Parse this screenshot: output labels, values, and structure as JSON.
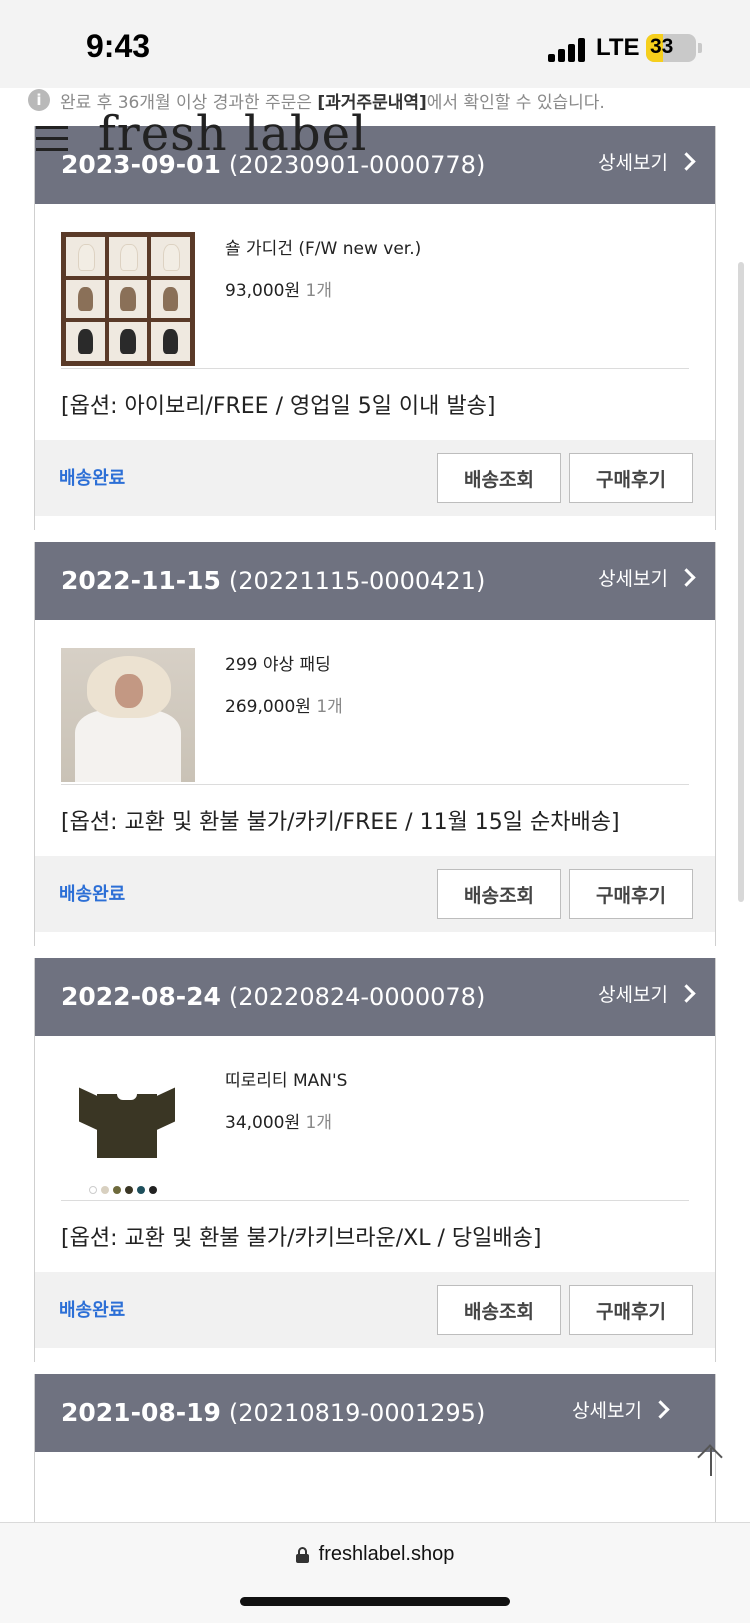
{
  "status_bar": {
    "time": "9:43",
    "network": "LTE",
    "battery": "33",
    "battery_level_pct": 33
  },
  "notice": {
    "prefix": "완료 후 36개월 이상 경과한 주문은 ",
    "link": "[과거주문내역]",
    "suffix": "에서 확인할 수 있습니다."
  },
  "header": {
    "logo": "fresh label"
  },
  "orders": [
    {
      "date": "2023-09-01",
      "order_no": "(20230901-0000778)",
      "detail_label": "상세보기",
      "product_name": "숄 가디건 (F/W new ver.)",
      "price": "93,000원",
      "qty": "1개",
      "options": "[옵션: 아이보리/FREE / 영업일 5일 이내 발송]",
      "status": "배송완료",
      "track_label": "배송조회",
      "review_label": "구매후기",
      "thumb_icon": "shawl-cardigan-image"
    },
    {
      "date": "2022-11-15",
      "order_no": "(20221115-0000421)",
      "detail_label": "상세보기",
      "product_name": "299 야상 패딩",
      "price": "269,000원",
      "qty": "1개",
      "options": "[옵션: 교환 및 환불 불가/카키/FREE / 11월 15일 순차배송]",
      "status": "배송완료",
      "track_label": "배송조회",
      "review_label": "구매후기",
      "thumb_icon": "padding-jacket-image"
    },
    {
      "date": "2022-08-24",
      "order_no": "(20220824-0000078)",
      "detail_label": "상세보기",
      "product_name": "띠로리티 MAN'S",
      "price": "34,000원",
      "qty": "1개",
      "options": "[옵션: 교환 및 환불 불가/카키브라운/XL / 당일배송]",
      "status": "배송완료",
      "track_label": "배송조회",
      "review_label": "구매후기",
      "thumb_icon": "tshirt-image",
      "swatch_colors": [
        "#ffffff",
        "#d8d0c0",
        "#6e6a3c",
        "#3a3624",
        "#1e4f5c",
        "#222222"
      ]
    },
    {
      "date": "2021-08-19",
      "order_no": "(20210819-0001295)",
      "detail_label": "상세보기"
    }
  ],
  "browser": {
    "url": "freshlabel.shop"
  },
  "colors": {
    "header_bg": "#6f7280",
    "status_blue": "#2c6fd6",
    "foot_bg": "#f1f1f1"
  }
}
